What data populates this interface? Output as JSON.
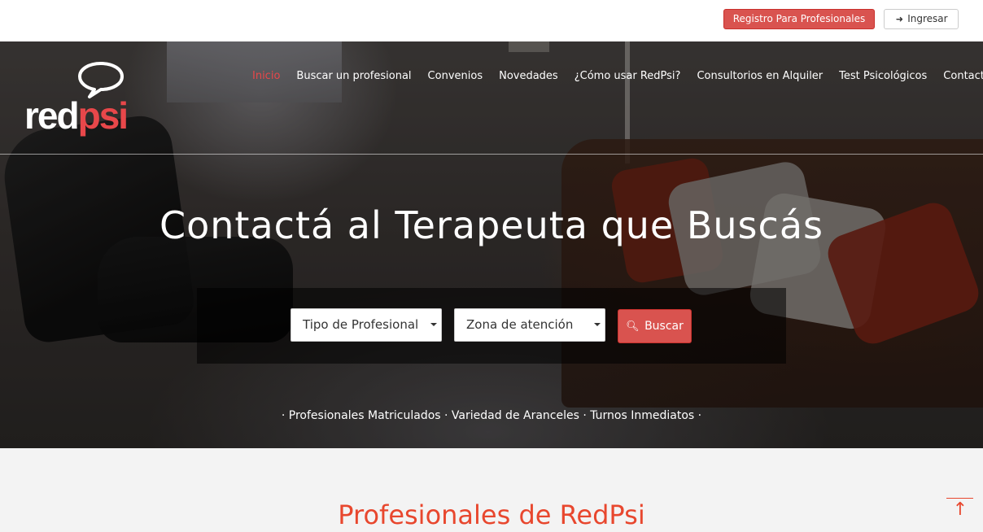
{
  "topbar": {
    "register_label": "Registro Para Profesionales",
    "login_label": "Ingresar",
    "login_icon": "sign-in-icon"
  },
  "logo": {
    "part1": "red",
    "part2": "psi",
    "brand_color": "#e8474a"
  },
  "nav": {
    "items": [
      {
        "label": "Inicio",
        "active": true
      },
      {
        "label": "Buscar un profesional"
      },
      {
        "label": "Convenios"
      },
      {
        "label": "Novedades"
      },
      {
        "label": "¿Cómo usar RedPsi?"
      },
      {
        "label": "Consultorios en Alquiler"
      },
      {
        "label": "Test Psicológicos"
      },
      {
        "label": "Contacto"
      }
    ],
    "active_color": "#e8474a"
  },
  "hero": {
    "headline": "Contactá al Terapeuta que Buscás",
    "search": {
      "type_select": "Tipo de Profesional",
      "zone_select": "Zona de atención",
      "button_label": "Buscar",
      "button_icon": "search-icon"
    },
    "features": "· Profesionales Matriculados · Variedad de Aranceles · Turnos Inmediatos ·"
  },
  "section": {
    "title": "Profesionales de RedPsi"
  },
  "colors": {
    "accent": "#d9534f",
    "title": "#e8472e"
  }
}
